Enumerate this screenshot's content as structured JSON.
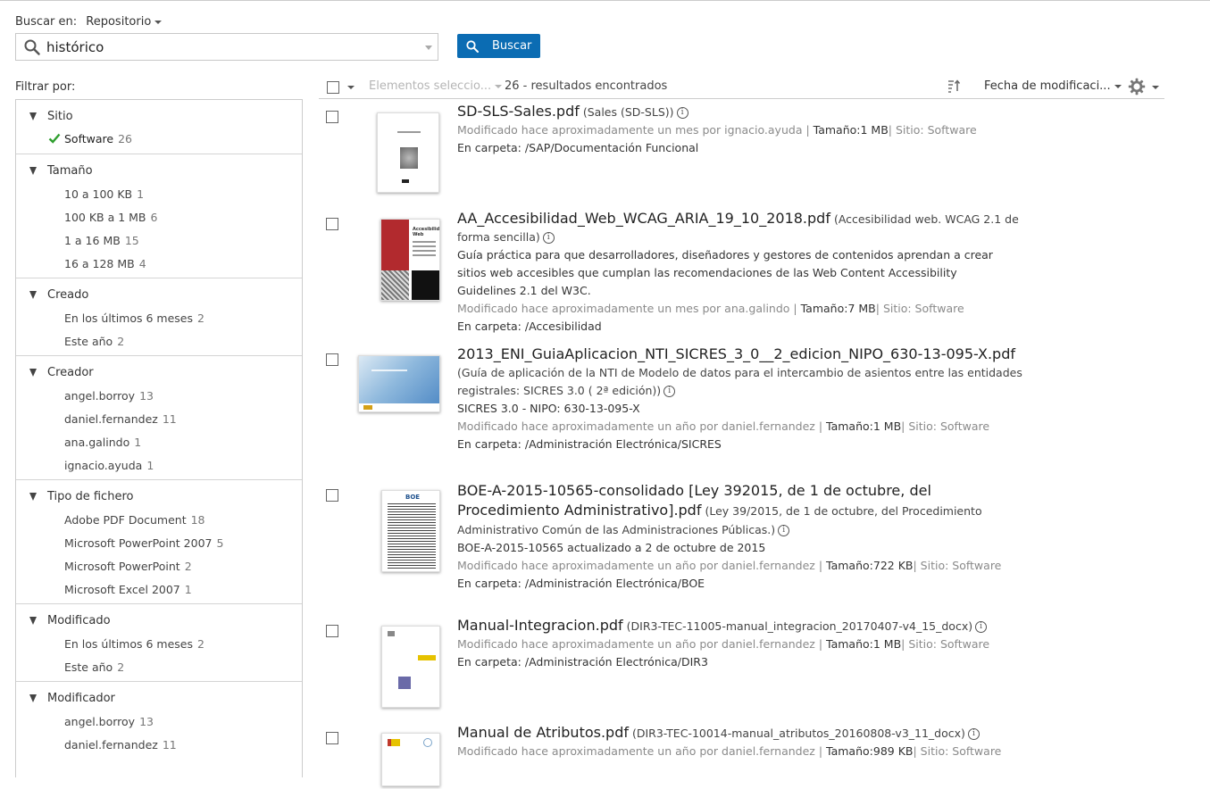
{
  "search": {
    "search_in_label": "Buscar en:",
    "scope": "Repositorio",
    "query": "histórico",
    "button": "Buscar"
  },
  "filters": {
    "title": "Filtrar por:",
    "groups": [
      {
        "label": "Sitio",
        "items": [
          {
            "label": "Software",
            "count": "26",
            "selected": true
          }
        ]
      },
      {
        "label": "Tamaño",
        "items": [
          {
            "label": "10 a 100 KB",
            "count": "1"
          },
          {
            "label": "100 KB a 1 MB",
            "count": "6"
          },
          {
            "label": "1 a 16 MB",
            "count": "15"
          },
          {
            "label": "16 a 128 MB",
            "count": "4"
          }
        ]
      },
      {
        "label": "Creado",
        "items": [
          {
            "label": "En los últimos 6 meses",
            "count": "2"
          },
          {
            "label": "Este año",
            "count": "2"
          }
        ]
      },
      {
        "label": "Creador",
        "items": [
          {
            "label": "angel.borroy",
            "count": "13"
          },
          {
            "label": "daniel.fernandez",
            "count": "11"
          },
          {
            "label": "ana.galindo",
            "count": "1"
          },
          {
            "label": "ignacio.ayuda",
            "count": "1"
          }
        ]
      },
      {
        "label": "Tipo de fichero",
        "items": [
          {
            "label": "Adobe PDF Document",
            "count": "18"
          },
          {
            "label": "Microsoft PowerPoint 2007",
            "count": "5"
          },
          {
            "label": "Microsoft PowerPoint",
            "count": "2"
          },
          {
            "label": "Microsoft Excel 2007",
            "count": "1"
          }
        ]
      },
      {
        "label": "Modificado",
        "items": [
          {
            "label": "En los últimos 6 meses",
            "count": "2"
          },
          {
            "label": "Este año",
            "count": "2"
          }
        ]
      },
      {
        "label": "Modificador",
        "items": [
          {
            "label": "angel.borroy",
            "count": "13"
          },
          {
            "label": "daniel.fernandez",
            "count": "11"
          }
        ]
      }
    ]
  },
  "results_header": {
    "selected_items": "Elementos seleccio...",
    "count": "26 - resultados encontrados",
    "sort_by": "Fecha de modificaci..."
  },
  "results": [
    {
      "title": "SD-SLS-Sales.pdf",
      "subtitle": "(Sales (SD-SLS))",
      "modified": "Modificado hace aproximadamente un mes por ignacio.ayuda",
      "size": "Tamaño:1 MB",
      "site": "Sitio: Software",
      "folder_label": "En carpeta:",
      "folder": "/SAP/Documentación Funcional"
    },
    {
      "title": "AA_Accesibilidad_Web_WCAG_ARIA_19_10_2018.pdf",
      "subtitle": "(Accesibilidad web. WCAG 2.1 de forma sencilla)",
      "description": "Guía práctica para que desarrolladores, diseñadores y gestores de contenidos aprendan a crear sitios web accesibles que cumplan las recomendaciones de las Web Content Accessibility Guidelines 2.1 del W3C.",
      "modified": "Modificado hace aproximadamente un mes por ana.galindo",
      "size": "Tamaño:7 MB",
      "site": "Sitio: Software",
      "folder_label": "En carpeta:",
      "folder": "/Accesibilidad",
      "thumb_text": "Accesibilidad Web"
    },
    {
      "title": "2013_ENI_GuiaAplicacion_NTI_SICRES_3_0__2_edicion_NIPO_630-13-095-X.pdf",
      "subtitle": "(Guía de aplicación de la NTI de Modelo de datos para el intercambio de asientos entre las entidades registrales: SICRES 3.0 ( 2ª edición))",
      "description": "SICRES 3.0 - NIPO: 630-13-095-X",
      "modified": "Modificado hace aproximadamente un año por daniel.fernandez",
      "size": "Tamaño:1 MB",
      "site": "Sitio: Software",
      "folder_label": "En carpeta:",
      "folder": "/Administración Electrónica/SICRES"
    },
    {
      "title": "BOE-A-2015-10565-consolidado [Ley 392015, de 1 de octubre, del Procedimiento Administrativo].pdf",
      "subtitle": "(Ley 39/2015, de 1 de octubre, del Procedimiento Administrativo Común de las Administraciones Públicas.)",
      "description": "BOE-A-2015-10565 actualizado a 2 de octubre de 2015",
      "modified": "Modificado hace aproximadamente un año por daniel.fernandez",
      "size": "Tamaño:722 KB",
      "site": "Sitio: Software",
      "folder_label": "En carpeta:",
      "folder": "/Administración Electrónica/BOE",
      "thumb_text": "BOE"
    },
    {
      "title": "Manual-Integracion.pdf",
      "subtitle": "(DIR3-TEC-11005-manual_integracion_20170407-v4_15_docx)",
      "modified": "Modificado hace aproximadamente un año por daniel.fernandez",
      "size": "Tamaño:1 MB",
      "site": "Sitio: Software",
      "folder_label": "En carpeta:",
      "folder": "/Administración Electrónica/DIR3"
    },
    {
      "title": "Manual de Atributos.pdf",
      "subtitle": "(DIR3-TEC-10014-manual_atributos_20160808-v3_11_docx)",
      "modified": "Modificado hace aproximadamente un año por daniel.fernandez",
      "size": "Tamaño:989 KB",
      "site": "Sitio: Software"
    }
  ],
  "colors": {
    "accent": "#0b6cb3",
    "check": "#2e9e2e",
    "muted": "#8a8a8a"
  }
}
